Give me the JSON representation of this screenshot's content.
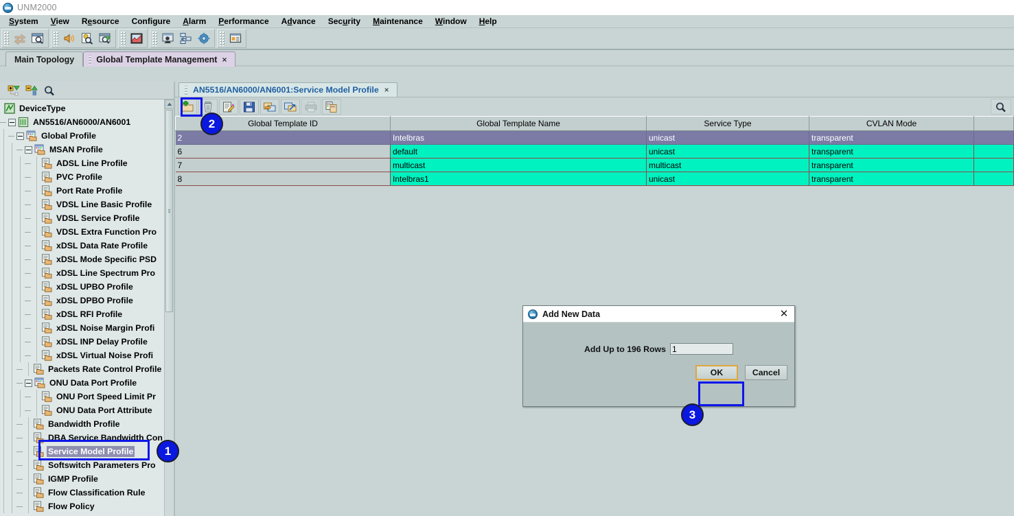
{
  "window": {
    "title": "UNM2000",
    "logo_icon": "unm-globe-icon"
  },
  "menubar": {
    "items": [
      {
        "label": "System",
        "mnemonic": "S"
      },
      {
        "label": "View",
        "mnemonic": "V"
      },
      {
        "label": "Resource",
        "mnemonic": "R"
      },
      {
        "label": "Configure",
        "mnemonic": "C"
      },
      {
        "label": "Alarm",
        "mnemonic": "A"
      },
      {
        "label": "Performance",
        "mnemonic": "P"
      },
      {
        "label": "Advance",
        "mnemonic": "d"
      },
      {
        "label": "Security",
        "mnemonic": "u"
      },
      {
        "label": "Maintenance",
        "mnemonic": "M"
      },
      {
        "label": "Window",
        "mnemonic": "W"
      },
      {
        "label": "Help",
        "mnemonic": "H"
      }
    ]
  },
  "main_toolbar": {
    "groups": [
      {
        "buttons": [
          {
            "icon": "refresh-arrows-icon",
            "disabled": true
          },
          {
            "icon": "window-search-icon",
            "disabled": false
          }
        ]
      },
      {
        "buttons": [
          {
            "icon": "speaker-sound-icon",
            "disabled": false
          },
          {
            "icon": "alarm-document-search-icon",
            "disabled": false
          },
          {
            "icon": "window-up-arrow-icon",
            "disabled": false
          }
        ]
      },
      {
        "buttons": [
          {
            "icon": "performance-chart-icon",
            "disabled": false
          }
        ]
      },
      {
        "buttons": [
          {
            "icon": "user-monitor-icon",
            "disabled": false
          },
          {
            "icon": "network-nodes-icon",
            "disabled": false
          },
          {
            "icon": "gear-settings-icon",
            "disabled": false
          }
        ]
      },
      {
        "buttons": [
          {
            "icon": "report-window-icon",
            "disabled": false
          }
        ]
      }
    ]
  },
  "tabs": {
    "items": [
      {
        "label": "Main Topology",
        "active": false,
        "closable": false
      },
      {
        "label": "Global Template Management",
        "active": true,
        "closable": true
      }
    ],
    "close_glyph": "×"
  },
  "left_panel": {
    "toolbar": [
      {
        "icon": "expand-all-icon"
      },
      {
        "icon": "collapse-all-icon"
      },
      {
        "icon": "search-icon"
      }
    ],
    "tree": [
      {
        "label": "DeviceType",
        "depth": 0,
        "icon": "device-type-icon",
        "toggle": "none",
        "selected": false
      },
      {
        "label": "AN5516/AN6000/AN6001",
        "depth": 1,
        "icon": "shelf-icon",
        "toggle": "minus",
        "selected": false
      },
      {
        "label": "Global Profile",
        "depth": 2,
        "icon": "folder-group-icon",
        "toggle": "minus",
        "selected": false
      },
      {
        "label": "MSAN Profile",
        "depth": 3,
        "icon": "folder-group-icon",
        "toggle": "minus",
        "selected": false
      },
      {
        "label": "ADSL Line Profile",
        "depth": 4,
        "icon": "profile-doc-icon",
        "toggle": "leaf",
        "selected": false
      },
      {
        "label": "PVC Profile",
        "depth": 4,
        "icon": "profile-doc-icon",
        "toggle": "leaf",
        "selected": false
      },
      {
        "label": "Port Rate Profile",
        "depth": 4,
        "icon": "profile-doc-icon",
        "toggle": "leaf",
        "selected": false
      },
      {
        "label": "VDSL Line Basic Profile",
        "depth": 4,
        "icon": "profile-doc-icon",
        "toggle": "leaf",
        "selected": false
      },
      {
        "label": "VDSL Service Profile",
        "depth": 4,
        "icon": "profile-doc-icon",
        "toggle": "leaf",
        "selected": false
      },
      {
        "label": "VDSL Extra Function Pro",
        "depth": 4,
        "icon": "profile-doc-icon",
        "toggle": "leaf",
        "selected": false
      },
      {
        "label": "xDSL Data Rate Profile",
        "depth": 4,
        "icon": "profile-doc-icon",
        "toggle": "leaf",
        "selected": false
      },
      {
        "label": "xDSL Mode Specific PSD",
        "depth": 4,
        "icon": "profile-doc-icon",
        "toggle": "leaf",
        "selected": false
      },
      {
        "label": "xDSL Line Spectrum Pro",
        "depth": 4,
        "icon": "profile-doc-icon",
        "toggle": "leaf",
        "selected": false
      },
      {
        "label": "xDSL UPBO Profile",
        "depth": 4,
        "icon": "profile-doc-icon",
        "toggle": "leaf",
        "selected": false
      },
      {
        "label": "xDSL DPBO Profile",
        "depth": 4,
        "icon": "profile-doc-icon",
        "toggle": "leaf",
        "selected": false
      },
      {
        "label": "xDSL RFI Profile",
        "depth": 4,
        "icon": "profile-doc-icon",
        "toggle": "leaf",
        "selected": false
      },
      {
        "label": "xDSL Noise Margin Profi",
        "depth": 4,
        "icon": "profile-doc-icon",
        "toggle": "leaf",
        "selected": false
      },
      {
        "label": "xDSL INP Delay Profile",
        "depth": 4,
        "icon": "profile-doc-icon",
        "toggle": "leaf",
        "selected": false
      },
      {
        "label": "xDSL Virtual Noise Profi",
        "depth": 4,
        "icon": "profile-doc-icon",
        "toggle": "leaf",
        "selected": false
      },
      {
        "label": "Packets Rate Control Profile",
        "depth": 3,
        "icon": "profile-doc-icon",
        "toggle": "leaf",
        "selected": false
      },
      {
        "label": "ONU Data Port Profile",
        "depth": 3,
        "icon": "folder-group-icon",
        "toggle": "minus",
        "selected": false
      },
      {
        "label": "ONU Port Speed Limit Pr",
        "depth": 4,
        "icon": "profile-doc-icon",
        "toggle": "leaf",
        "selected": false
      },
      {
        "label": "ONU Data Port Attribute",
        "depth": 4,
        "icon": "profile-doc-icon",
        "toggle": "leaf",
        "selected": false
      },
      {
        "label": "Bandwidth Profile",
        "depth": 3,
        "icon": "profile-doc-icon",
        "toggle": "leaf",
        "selected": false
      },
      {
        "label": "DBA Service Bandwidth Con",
        "depth": 3,
        "icon": "profile-doc-icon",
        "toggle": "leaf",
        "selected": false
      },
      {
        "label": "Service Model Profile",
        "depth": 3,
        "icon": "profile-doc-icon",
        "toggle": "leaf",
        "selected": true
      },
      {
        "label": "Softswitch Parameters Pro",
        "depth": 3,
        "icon": "profile-doc-icon",
        "toggle": "leaf",
        "selected": false
      },
      {
        "label": "IGMP Profile",
        "depth": 3,
        "icon": "profile-doc-icon",
        "toggle": "leaf",
        "selected": false
      },
      {
        "label": "Flow Classification Rule",
        "depth": 3,
        "icon": "profile-doc-icon",
        "toggle": "leaf",
        "selected": false
      },
      {
        "label": "Flow Policy",
        "depth": 3,
        "icon": "profile-doc-icon",
        "toggle": "leaf",
        "selected": false
      }
    ]
  },
  "content": {
    "tab": {
      "label": "AN5516/AN6000/AN6001:Service Model Profile",
      "close_glyph": "×"
    },
    "toolbar": [
      {
        "icon": "add-new-folder-icon",
        "disabled": false,
        "highlighted": true
      },
      {
        "icon": "delete-trash-icon",
        "disabled": false,
        "highlighted": false
      },
      {
        "icon": "edit-document-icon",
        "disabled": false,
        "highlighted": false
      },
      {
        "icon": "save-floppy-icon",
        "disabled": false,
        "highlighted": false
      },
      {
        "icon": "apply-to-device-icon",
        "disabled": false,
        "highlighted": false
      },
      {
        "icon": "upload-template-icon",
        "disabled": false,
        "highlighted": false
      },
      {
        "icon": "print-icon",
        "disabled": true,
        "highlighted": false
      },
      {
        "icon": "copy-template-icon",
        "disabled": false,
        "highlighted": false
      }
    ],
    "search_icon": "search-icon",
    "table": {
      "columns": [
        {
          "label": "Global Template ID",
          "key": "id"
        },
        {
          "label": "Global Template Name",
          "key": "name"
        },
        {
          "label": "Service Type",
          "key": "service_type"
        },
        {
          "label": "CVLAN Mode",
          "key": "cvlan_mode"
        },
        {
          "label": "",
          "key": "extra"
        }
      ],
      "rows": [
        {
          "id": "2",
          "name": "Intelbras",
          "service_type": "unicast",
          "cvlan_mode": "transparent",
          "extra": "",
          "selected": true
        },
        {
          "id": "6",
          "name": "default",
          "service_type": "unicast",
          "cvlan_mode": "transparent",
          "extra": "",
          "selected": false
        },
        {
          "id": "7",
          "name": "multicast",
          "service_type": "multicast",
          "cvlan_mode": "transparent",
          "extra": "",
          "selected": false
        },
        {
          "id": "8",
          "name": "Intelbras1",
          "service_type": "unicast",
          "cvlan_mode": "transparent",
          "extra": "",
          "selected": false
        }
      ]
    }
  },
  "dialog": {
    "title": "Add New Data",
    "logo_icon": "unm-globe-icon",
    "close_glyph": "✕",
    "field_label": "Add Up to 196 Rows",
    "field_value": "1",
    "ok_label": "OK",
    "cancel_label": "Cancel"
  },
  "annotations": {
    "badges": [
      {
        "number": "1"
      },
      {
        "number": "2"
      },
      {
        "number": "3"
      }
    ],
    "highlight_color": "#0d16e8"
  },
  "colors": {
    "selected_row": "#7b7ba6",
    "data_row": "#00f2c0",
    "accent": "#0d16e8",
    "focus_ring": "#e0a63c",
    "tab_active": "#dcd2e6",
    "link_text": "#1f5fa0"
  }
}
